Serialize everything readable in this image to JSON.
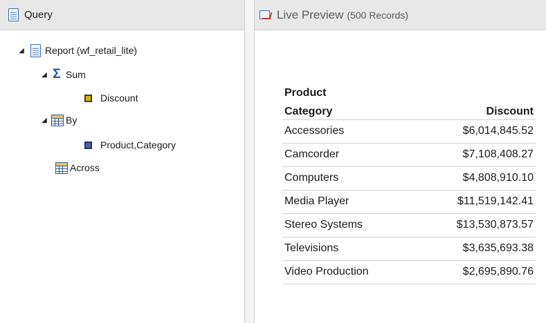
{
  "query_panel": {
    "title": "Query",
    "tree": {
      "report": "Report (wf_retail_lite)",
      "sum": "Sum",
      "sum_field": "Discount",
      "by": "By",
      "by_field": "Product,Category",
      "across": "Across"
    }
  },
  "preview": {
    "title": "Live Preview",
    "record_count": "(500 Records)"
  },
  "report": {
    "header_line1": "Product",
    "header_category": "Category",
    "header_discount": "Discount",
    "rows": [
      {
        "category": "Accessories",
        "discount": "$6,014,845.52"
      },
      {
        "category": "Camcorder",
        "discount": "$7,108,408.27"
      },
      {
        "category": "Computers",
        "discount": "$4,808,910.10"
      },
      {
        "category": "Media Player",
        "discount": "$11,519,142.41"
      },
      {
        "category": "Stereo Systems",
        "discount": "$13,530,873.57"
      },
      {
        "category": "Televisions",
        "discount": "$3,635,693.38"
      },
      {
        "category": "Video Production",
        "discount": "$2,695,890.76"
      }
    ]
  }
}
